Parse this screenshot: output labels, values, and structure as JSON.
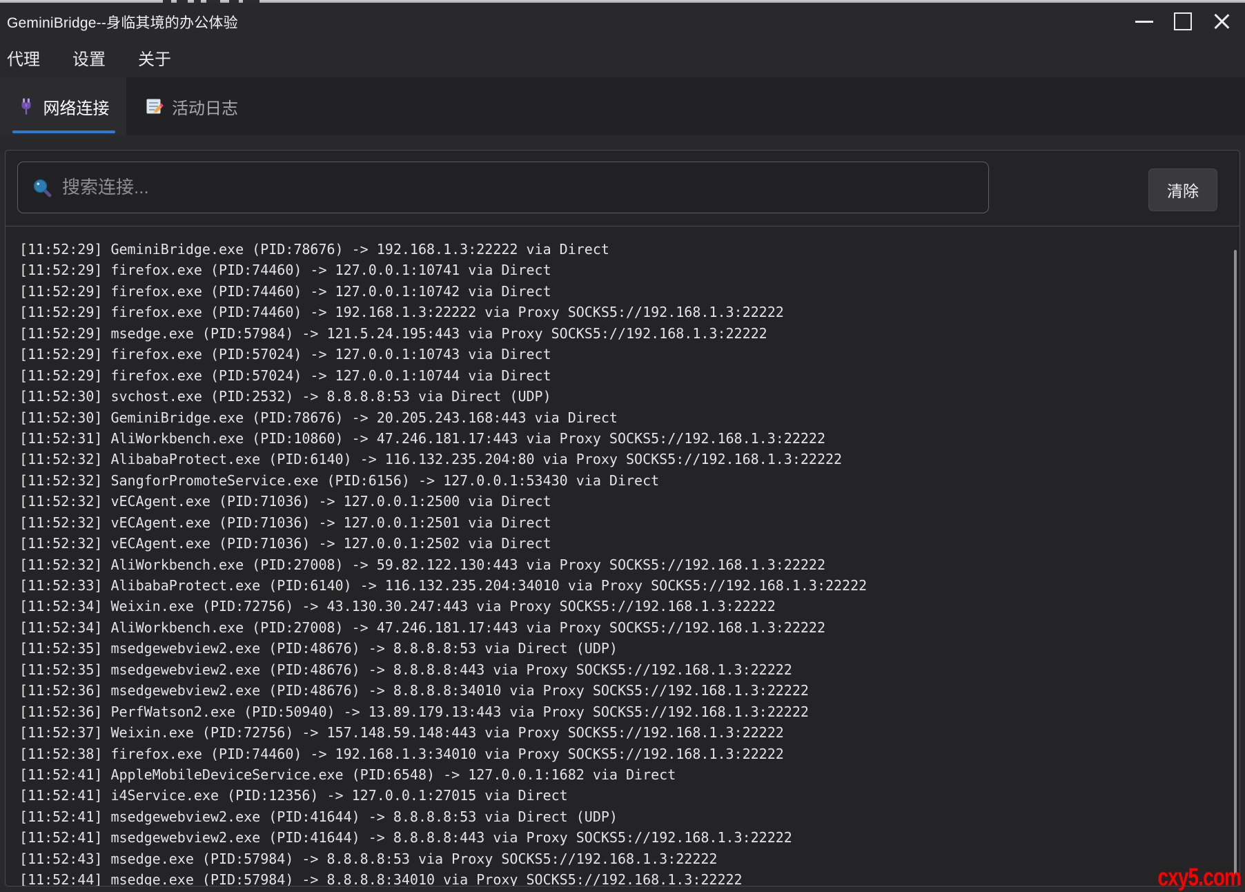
{
  "window": {
    "title": "GeminiBridge--身临其境的办公体验",
    "controls": [
      {
        "name": "minimize"
      },
      {
        "name": "maximize"
      },
      {
        "name": "close"
      }
    ]
  },
  "menu": {
    "items": [
      {
        "label": "代理"
      },
      {
        "label": "设置"
      },
      {
        "label": "关于"
      }
    ]
  },
  "tabs": [
    {
      "label": "网络连接",
      "icon": "plug-icon",
      "active": true
    },
    {
      "label": "活动日志",
      "icon": "memo-pencil-icon",
      "active": false
    }
  ],
  "search": {
    "placeholder": "搜索连接...",
    "icon": "magnifier",
    "clear_label": "清除"
  },
  "log": {
    "lines": [
      "[11:52:29] GeminiBridge.exe (PID:78676) -> 192.168.1.3:22222 via Direct",
      "[11:52:29] firefox.exe (PID:74460) -> 127.0.0.1:10741 via Direct",
      "[11:52:29] firefox.exe (PID:74460) -> 127.0.0.1:10742 via Direct",
      "[11:52:29] firefox.exe (PID:74460) -> 192.168.1.3:22222 via Proxy SOCKS5://192.168.1.3:22222",
      "[11:52:29] msedge.exe (PID:57984) -> 121.5.24.195:443 via Proxy SOCKS5://192.168.1.3:22222",
      "[11:52:29] firefox.exe (PID:57024) -> 127.0.0.1:10743 via Direct",
      "[11:52:29] firefox.exe (PID:57024) -> 127.0.0.1:10744 via Direct",
      "[11:52:30] svchost.exe (PID:2532) -> 8.8.8.8:53 via Direct (UDP)",
      "[11:52:30] GeminiBridge.exe (PID:78676) -> 20.205.243.168:443 via Direct",
      "[11:52:31] AliWorkbench.exe (PID:10860) -> 47.246.181.17:443 via Proxy SOCKS5://192.168.1.3:22222",
      "[11:52:32] AlibabaProtect.exe (PID:6140) -> 116.132.235.204:80 via Proxy SOCKS5://192.168.1.3:22222",
      "[11:52:32] SangforPromoteService.exe (PID:6156) -> 127.0.0.1:53430 via Direct",
      "[11:52:32] vECAgent.exe (PID:71036) -> 127.0.0.1:2500 via Direct",
      "[11:52:32] vECAgent.exe (PID:71036) -> 127.0.0.1:2501 via Direct",
      "[11:52:32] vECAgent.exe (PID:71036) -> 127.0.0.1:2502 via Direct",
      "[11:52:32] AliWorkbench.exe (PID:27008) -> 59.82.122.130:443 via Proxy SOCKS5://192.168.1.3:22222",
      "[11:52:33] AlibabaProtect.exe (PID:6140) -> 116.132.235.204:34010 via Proxy SOCKS5://192.168.1.3:22222",
      "[11:52:34] Weixin.exe (PID:72756) -> 43.130.30.247:443 via Proxy SOCKS5://192.168.1.3:22222",
      "[11:52:34] AliWorkbench.exe (PID:27008) -> 47.246.181.17:443 via Proxy SOCKS5://192.168.1.3:22222",
      "[11:52:35] msedgewebview2.exe (PID:48676) -> 8.8.8.8:53 via Direct (UDP)",
      "[11:52:35] msedgewebview2.exe (PID:48676) -> 8.8.8.8:443 via Proxy SOCKS5://192.168.1.3:22222",
      "[11:52:36] msedgewebview2.exe (PID:48676) -> 8.8.8.8:34010 via Proxy SOCKS5://192.168.1.3:22222",
      "[11:52:36] PerfWatson2.exe (PID:50940) -> 13.89.179.13:443 via Proxy SOCKS5://192.168.1.3:22222",
      "[11:52:37] Weixin.exe (PID:72756) -> 157.148.59.148:443 via Proxy SOCKS5://192.168.1.3:22222",
      "[11:52:38] firefox.exe (PID:74460) -> 192.168.1.3:34010 via Proxy SOCKS5://192.168.1.3:22222",
      "[11:52:41] AppleMobileDeviceService.exe (PID:6548) -> 127.0.0.1:1682 via Direct",
      "[11:52:41] i4Service.exe (PID:12356) -> 127.0.0.1:27015 via Direct",
      "[11:52:41] msedgewebview2.exe (PID:41644) -> 8.8.8.8:53 via Direct (UDP)",
      "[11:52:41] msedgewebview2.exe (PID:41644) -> 8.8.8.8:443 via Proxy SOCKS5://192.168.1.3:22222",
      "[11:52:43] msedge.exe (PID:57984) -> 8.8.8.8:53 via Proxy SOCKS5://192.168.1.3:22222",
      "[11:52:44] msedge.exe (PID:57984) -> 8.8.8.8:34010 via Proxy SOCKS5://192.168.1.3:22222"
    ]
  },
  "watermark": {
    "text": "cxy5.com"
  },
  "colors": {
    "accent_underline": "#2f7ad2",
    "watermark_red": "#ff0000",
    "window_bg": "#29292b",
    "panel_bg": "#242426"
  }
}
